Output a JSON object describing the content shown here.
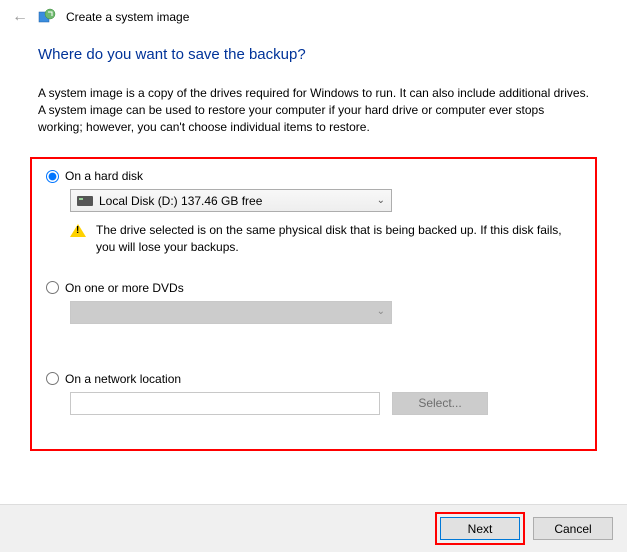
{
  "header": {
    "title": "Create a system image"
  },
  "page": {
    "title": "Where do you want to save the backup?",
    "description": "A system image is a copy of the drives required for Windows to run. It can also include additional drives. A system image can be used to restore your computer if your hard drive or computer ever stops working; however, you can't choose individual items to restore."
  },
  "options": {
    "hard_disk": {
      "label": "On a hard disk",
      "selected_disk": "Local Disk (D:)  137.46 GB free",
      "warning": "The drive selected is on the same physical disk that is being backed up. If this disk fails, you will lose your backups."
    },
    "dvd": {
      "label": "On one or more DVDs"
    },
    "network": {
      "label": "On a network location",
      "select_button": "Select..."
    }
  },
  "footer": {
    "next": "Next",
    "cancel": "Cancel"
  }
}
